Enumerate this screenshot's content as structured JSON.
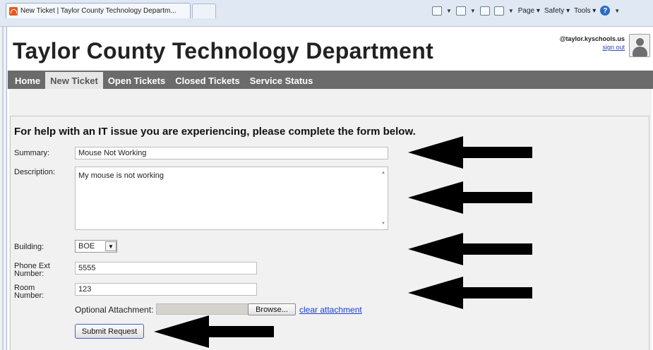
{
  "browser": {
    "tab_title": "New Ticket | Taylor County Technology Departm...",
    "toolbar": {
      "page_label": "Page",
      "safety_label": "Safety",
      "tools_label": "Tools"
    }
  },
  "header": {
    "site_title": "Taylor County Technology Department",
    "user_email": "@taylor.kyschools.us",
    "signout_label": "sign out"
  },
  "nav": {
    "items": [
      {
        "label": "Home",
        "active": false
      },
      {
        "label": "New Ticket",
        "active": true
      },
      {
        "label": "Open Tickets",
        "active": false
      },
      {
        "label": "Closed Tickets",
        "active": false
      },
      {
        "label": "Service Status",
        "active": false
      }
    ]
  },
  "form": {
    "heading": "For help with an IT issue you are experiencing, please complete the form below.",
    "summary": {
      "label": "Summary:",
      "value": "Mouse Not Working"
    },
    "description": {
      "label": "Description:",
      "value": "My mouse is not working"
    },
    "building": {
      "label": "Building:",
      "value": "BOE"
    },
    "phone": {
      "label_line1": "Phone Ext",
      "label_line2": "Number:",
      "value": "5555"
    },
    "room": {
      "label_line1": "Room",
      "label_line2": "Number:",
      "value": "123"
    },
    "attachment": {
      "label": "Optional Attachment:",
      "browse_label": "Browse...",
      "clear_label": "clear attachment"
    },
    "submit_label": "Submit Request"
  },
  "colors": {
    "navbar": "#6b6b6b",
    "nav_active_bg": "#e6e6e6",
    "content_bg": "#f1f1f1",
    "link": "#1d3fcf",
    "annotation_arrow": "#000000"
  }
}
